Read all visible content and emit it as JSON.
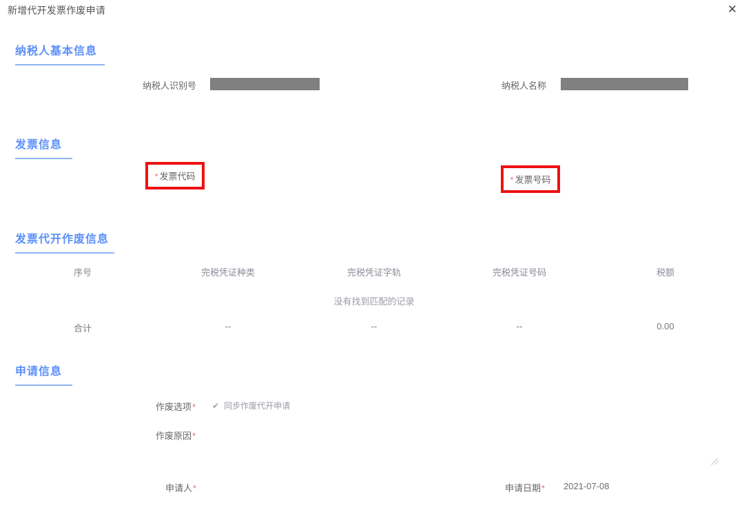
{
  "window": {
    "title": "新增代开发票作废申请",
    "close_icon": "close-icon",
    "close_glyph": "✕"
  },
  "theme": {
    "heading_blue": "#5b8ff9",
    "heading_underline": "#8fb4f2",
    "required_red": "#f56c6c",
    "annotation_red": "#ee1111",
    "mask_gray": "#808080",
    "body_text": "#666666"
  },
  "sections": {
    "taxpayer": {
      "heading": "纳税人基本信息",
      "fields": [
        {
          "label": "纳税人识别号",
          "value": "",
          "masked": true
        },
        {
          "label": "纳税人名称",
          "value": "",
          "masked": true
        }
      ]
    },
    "invoice": {
      "heading": "发票信息",
      "fields": [
        {
          "label": "发票代码",
          "required": true,
          "required_marker": "*",
          "highlighted": true
        },
        {
          "label": "发票号码",
          "required": true,
          "required_marker": "*",
          "highlighted": true
        }
      ]
    },
    "void_info": {
      "heading": "发票代开作废信息",
      "table": {
        "columns": [
          "序号",
          "完税凭证种类",
          "完税凭证字轨",
          "完税凭证号码",
          "税额"
        ],
        "empty_text": "没有找到匹配的记录",
        "rows": [],
        "total_row": [
          "合计",
          "--",
          "--",
          "--",
          "0.00"
        ]
      }
    },
    "application": {
      "heading": "申请信息",
      "fields": [
        {
          "label": "作废选项",
          "required": true,
          "required_marker": "*",
          "checkbox": {
            "label": "同步作废代开申请",
            "checked": true,
            "glyph": "✔"
          }
        },
        {
          "label": "作废原因",
          "required": true,
          "required_marker": "*",
          "value": ""
        },
        {
          "label": "申请人",
          "required": true,
          "required_marker": "*",
          "value": ""
        },
        {
          "label": "申请日期",
          "required": true,
          "required_marker": "*",
          "value": "2021-07-08"
        }
      ]
    }
  }
}
